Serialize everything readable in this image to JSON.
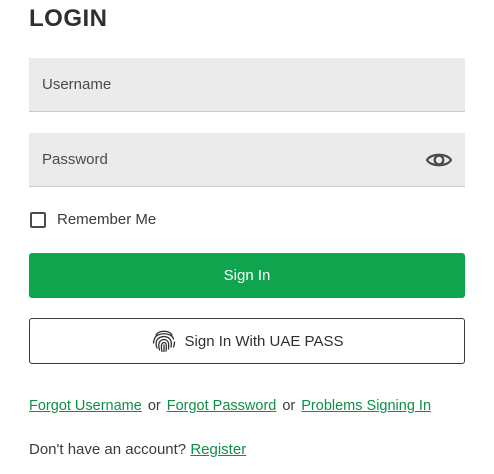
{
  "login": {
    "title": "LOGIN",
    "username_placeholder": "Username",
    "password_placeholder": "Password",
    "remember_label": "Remember Me",
    "remember_checked": false,
    "signin_label": "Sign In",
    "uaepass_label": "Sign In With UAE PASS"
  },
  "links": {
    "forgot_username": "Forgot Username",
    "or_1": "or",
    "forgot_password": "Forgot Password",
    "or_2": "or",
    "problems": "Problems Signing In"
  },
  "register": {
    "prompt": "Don't have an account?",
    "link": "Register"
  },
  "icons": {
    "password_toggle": "eye-icon",
    "uaepass": "fingerprint-icon"
  },
  "colors": {
    "accent": "#0ea54e",
    "link": "#0e8f46",
    "field_bg": "#ebebeb"
  }
}
